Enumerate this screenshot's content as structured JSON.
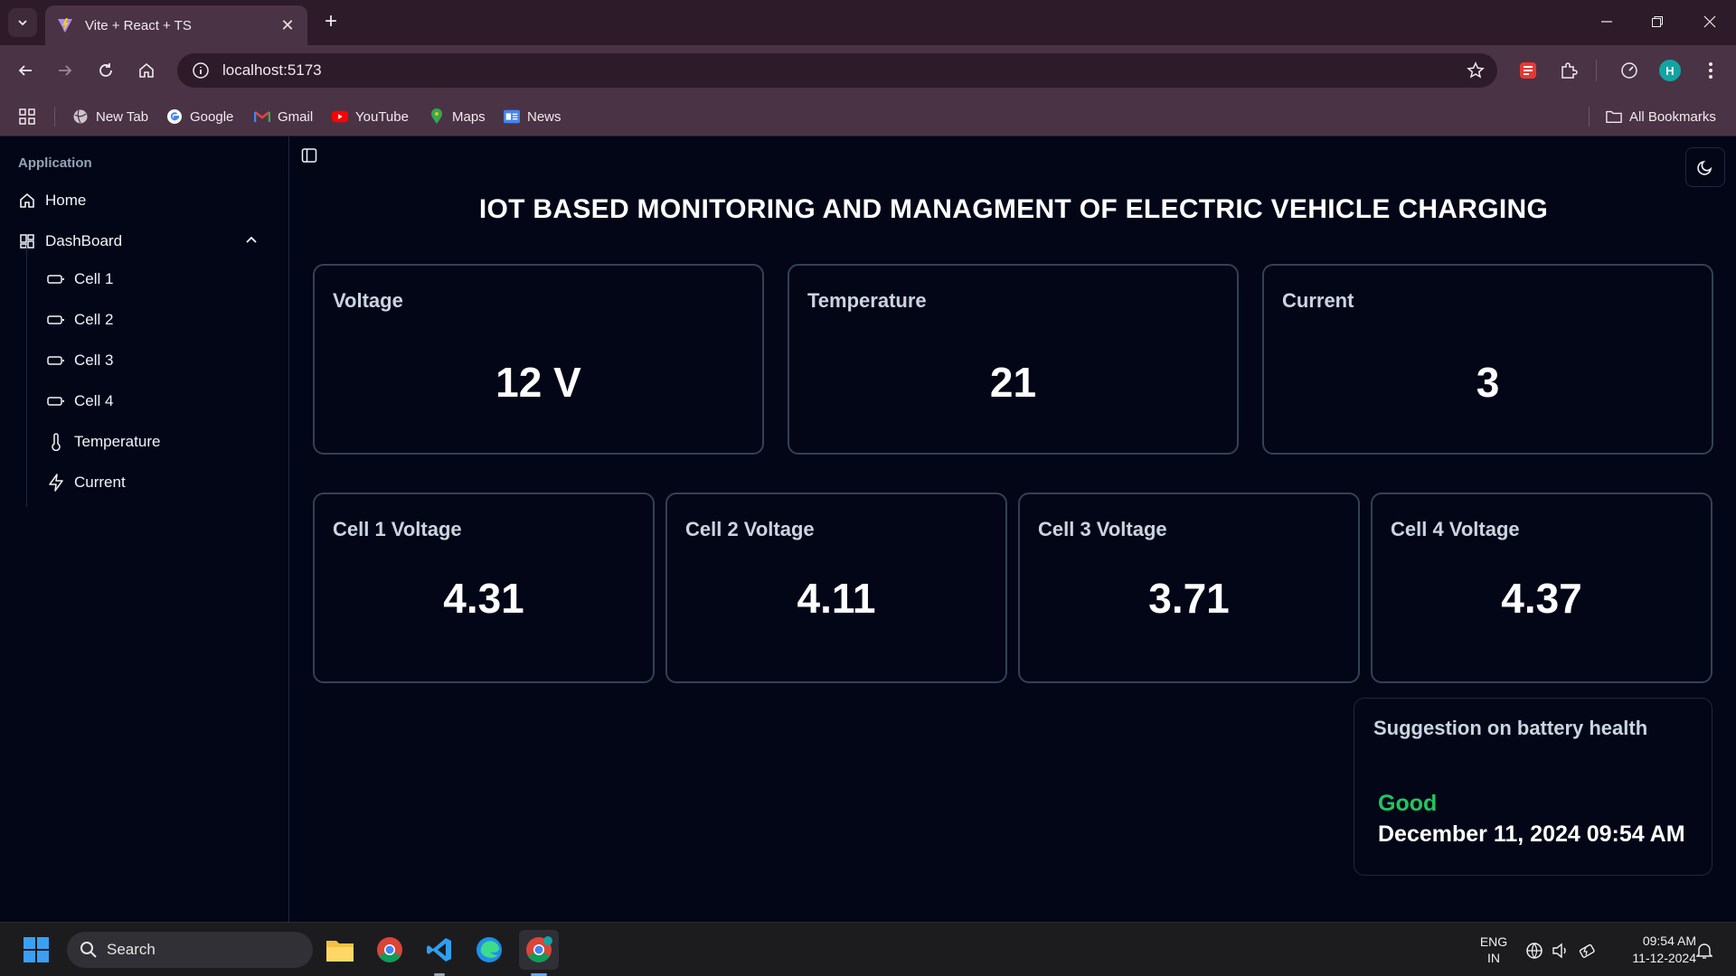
{
  "browser": {
    "tab_title": "Vite + React + TS",
    "url": "localhost:5173",
    "profile_initial": "H",
    "bookmarks": [
      {
        "label": "New Tab",
        "icon": "globe-icon"
      },
      {
        "label": "Google",
        "icon": "google-icon"
      },
      {
        "label": "Gmail",
        "icon": "gmail-icon"
      },
      {
        "label": "YouTube",
        "icon": "youtube-icon"
      },
      {
        "label": "Maps",
        "icon": "maps-icon"
      },
      {
        "label": "News",
        "icon": "news-icon"
      }
    ],
    "all_bookmarks_label": "All Bookmarks"
  },
  "sidebar": {
    "group_label": "Application",
    "home_label": "Home",
    "dashboard_label": "DashBoard",
    "sub_items": [
      {
        "label": "Cell 1",
        "icon": "battery-icon"
      },
      {
        "label": "Cell 2",
        "icon": "battery-icon"
      },
      {
        "label": "Cell 3",
        "icon": "battery-icon"
      },
      {
        "label": "Cell 4",
        "icon": "battery-icon"
      },
      {
        "label": "Temperature",
        "icon": "thermometer-icon"
      },
      {
        "label": "Current",
        "icon": "zap-icon"
      }
    ]
  },
  "main": {
    "title": "IOT BASED MONITORING AND MANAGMENT OF ELECTRIC VEHICLE CHARGING",
    "top_cards": [
      {
        "label": "Voltage",
        "value": "12 V"
      },
      {
        "label": "Temperature",
        "value": "21"
      },
      {
        "label": "Current",
        "value": "3"
      }
    ],
    "cell_cards": [
      {
        "label": "Cell 1 Voltage",
        "value": "4.31"
      },
      {
        "label": "Cell 2 Voltage",
        "value": "4.11"
      },
      {
        "label": "Cell 3 Voltage",
        "value": "3.71"
      },
      {
        "label": "Cell 4 Voltage",
        "value": "4.37"
      }
    ],
    "suggestion": {
      "label": "Suggestion on battery health",
      "status": "Good",
      "timestamp": "December 11, 2024 09:54 AM"
    }
  },
  "taskbar": {
    "search_placeholder": "Search",
    "lang_line1": "ENG",
    "lang_line2": "IN",
    "time": "09:54 AM",
    "date": "11-12-2024"
  },
  "colors": {
    "background": "#020617",
    "card_border": "#334155",
    "good_status": "#22c55e",
    "chrome_bg": "#4a3345"
  }
}
